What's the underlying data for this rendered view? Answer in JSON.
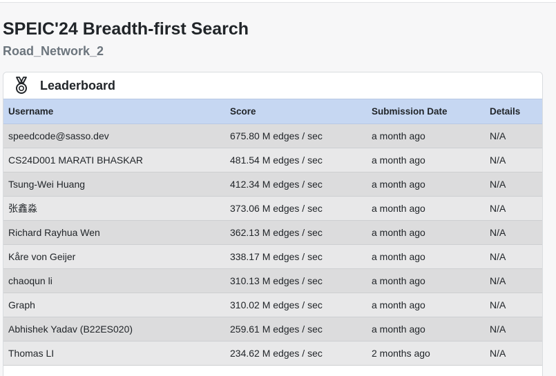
{
  "page": {
    "title": "SPEIC'24 Breadth-first Search",
    "subtitle": "Road_Network_2"
  },
  "leaderboard": {
    "title": "Leaderboard",
    "icon": "medal-icon",
    "columns": [
      "Username",
      "Score",
      "Submission Date",
      "Details"
    ],
    "rows": [
      {
        "username": "speedcode@sasso.dev",
        "score": "675.80 M edges / sec",
        "date": "a month ago",
        "details": "N/A"
      },
      {
        "username": "CS24D001 MARATI BHASKAR",
        "score": "481.54 M edges / sec",
        "date": "a month ago",
        "details": "N/A"
      },
      {
        "username": "Tsung-Wei Huang",
        "score": "412.34 M edges / sec",
        "date": "a month ago",
        "details": "N/A"
      },
      {
        "username": "张鑫淼",
        "score": "373.06 M edges / sec",
        "date": "a month ago",
        "details": "N/A"
      },
      {
        "username": "Richard Rayhua Wen",
        "score": "362.13 M edges / sec",
        "date": "a month ago",
        "details": "N/A"
      },
      {
        "username": "Kåre von Geijer",
        "score": "338.17 M edges / sec",
        "date": "a month ago",
        "details": "N/A"
      },
      {
        "username": "chaoqun li",
        "score": "310.13 M edges / sec",
        "date": "a month ago",
        "details": "N/A"
      },
      {
        "username": "Graph",
        "score": "310.02 M edges / sec",
        "date": "a month ago",
        "details": "N/A"
      },
      {
        "username": "Abhishek Yadav (B22ES020)",
        "score": "259.61 M edges / sec",
        "date": "a month ago",
        "details": "N/A"
      },
      {
        "username": "Thomas LI",
        "score": "234.62 M edges / sec",
        "date": "2 months ago",
        "details": "N/A"
      }
    ]
  }
}
